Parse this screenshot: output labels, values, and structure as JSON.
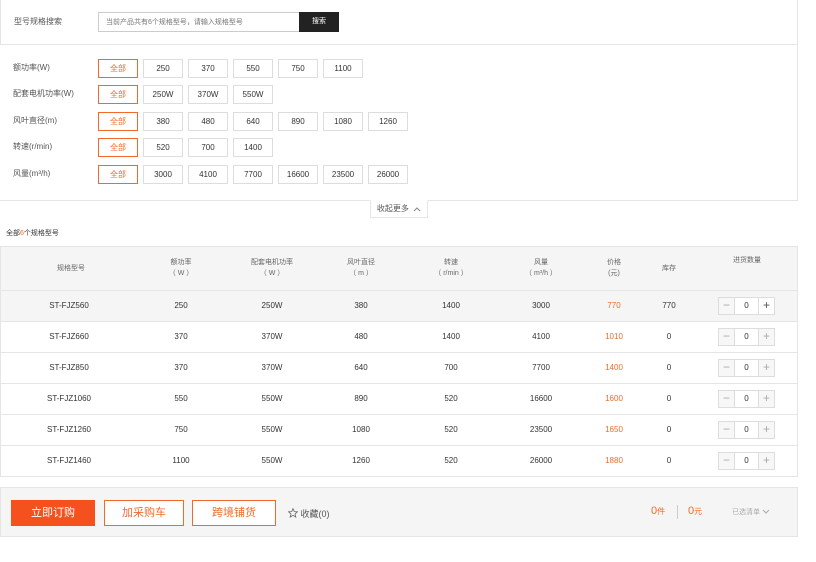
{
  "search": {
    "label": "型号规格搜索",
    "placeholder": "当前产品共有6个规格型号，请输入规格型号",
    "button": "搜索"
  },
  "filters": [
    {
      "label": "额功率(W)",
      "options": [
        "全部",
        "250",
        "370",
        "550",
        "750",
        "1100"
      ],
      "active": 0
    },
    {
      "label": "配套电机功率(W)",
      "options": [
        "全部",
        "250W",
        "370W",
        "550W"
      ],
      "active": 0
    },
    {
      "label": "风叶直径(m)",
      "options": [
        "全部",
        "380",
        "480",
        "640",
        "890",
        "1080",
        "1260"
      ],
      "active": 0
    },
    {
      "label": "转速(r/min)",
      "options": [
        "全部",
        "520",
        "700",
        "1400"
      ],
      "active": 0
    },
    {
      "label": "风量(m³/h)",
      "options": [
        "全部",
        "3000",
        "4100",
        "7700",
        "16600",
        "23500",
        "26000"
      ],
      "active": 0
    }
  ],
  "collapse": {
    "label": "收起更多",
    "icon": "chevron-up-icon"
  },
  "count": {
    "prefix": "全部",
    "num": "6",
    "suffix": "个规格型号"
  },
  "table": {
    "headers": [
      {
        "l1": "规格型号",
        "l2": ""
      },
      {
        "l1": "额功率",
        "l2": "（ W ）"
      },
      {
        "l1": "配套电机功率",
        "l2": "（ W ）"
      },
      {
        "l1": "风叶直径",
        "l2": "（ m ）"
      },
      {
        "l1": "转速",
        "l2": "（ r/min ）"
      },
      {
        "l1": "风量",
        "l2": "（ m³/h ）"
      },
      {
        "l1": "价格",
        "l2": "(元)"
      },
      {
        "l1": "库存",
        "l2": ""
      },
      {
        "l1": "进货数量",
        "l2": ""
      }
    ],
    "rows": [
      {
        "model": "ST-FJZ560",
        "power": "250",
        "motor": "250W",
        "diameter": "380",
        "speed": "1400",
        "flow": "3000",
        "price": "770",
        "stock": "770",
        "qty": "0"
      },
      {
        "model": "ST-FJZ660",
        "power": "370",
        "motor": "370W",
        "diameter": "480",
        "speed": "1400",
        "flow": "4100",
        "price": "1010",
        "stock": "0",
        "qty": "0"
      },
      {
        "model": "ST-FJZ850",
        "power": "370",
        "motor": "370W",
        "diameter": "640",
        "speed": "700",
        "flow": "7700",
        "price": "1400",
        "stock": "0",
        "qty": "0"
      },
      {
        "model": "ST-FJZ1060",
        "power": "550",
        "motor": "550W",
        "diameter": "890",
        "speed": "520",
        "flow": "16600",
        "price": "1600",
        "stock": "0",
        "qty": "0"
      },
      {
        "model": "ST-FJZ1260",
        "power": "750",
        "motor": "550W",
        "diameter": "1080",
        "speed": "520",
        "flow": "23500",
        "price": "1650",
        "stock": "0",
        "qty": "0"
      },
      {
        "model": "ST-FJZ1460",
        "power": "1100",
        "motor": "550W",
        "diameter": "1260",
        "speed": "520",
        "flow": "26000",
        "price": "1880",
        "stock": "0",
        "qty": "0"
      }
    ]
  },
  "stepper": {
    "minus": "−",
    "plus": "+"
  },
  "actions": {
    "buy_now": "立即订购",
    "add_cart": "加采购车",
    "cross_shop": "跨境铺货",
    "favorite": "收藏(0)"
  },
  "summary": {
    "qty": "0",
    "qty_unit": "件",
    "price": "0",
    "price_unit": "元",
    "selected_list": "已选清单"
  },
  "colors": {
    "accent": "#f26a2b",
    "buy_now_bg": "#f4511e"
  }
}
